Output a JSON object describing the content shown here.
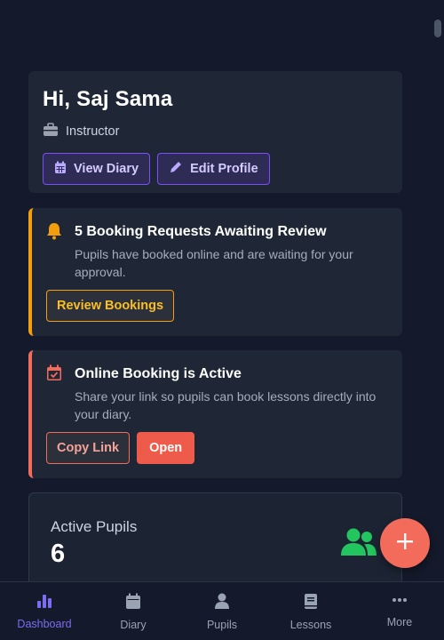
{
  "header": {
    "greeting": "Hi, Saj Sama",
    "role": "Instructor",
    "view_diary_label": "View Diary",
    "edit_profile_label": "Edit Profile"
  },
  "booking_alert": {
    "title": "5 Booking Requests Awaiting Review",
    "description": "Pupils have booked online and are waiting for your approval.",
    "button_label": "Review Bookings",
    "accent": "#f59e0b"
  },
  "online_booking": {
    "title": "Online Booking is Active",
    "description": "Share your link so pupils can book lessons directly into your diary.",
    "copy_label": "Copy Link",
    "open_label": "Open",
    "accent": "#f26b5b"
  },
  "stats": {
    "label": "Active Pupils",
    "value": "6",
    "icon": "users-icon"
  },
  "fab": {
    "icon": "plus-icon"
  },
  "nav": {
    "items": [
      {
        "label": "Dashboard",
        "icon": "chart-bars-icon",
        "active": true
      },
      {
        "label": "Diary",
        "icon": "calendar-icon",
        "active": false
      },
      {
        "label": "Pupils",
        "icon": "user-icon",
        "active": false
      },
      {
        "label": "Lessons",
        "icon": "book-icon",
        "active": false
      },
      {
        "label": "More",
        "icon": "more-dots-icon",
        "active": false
      }
    ]
  }
}
